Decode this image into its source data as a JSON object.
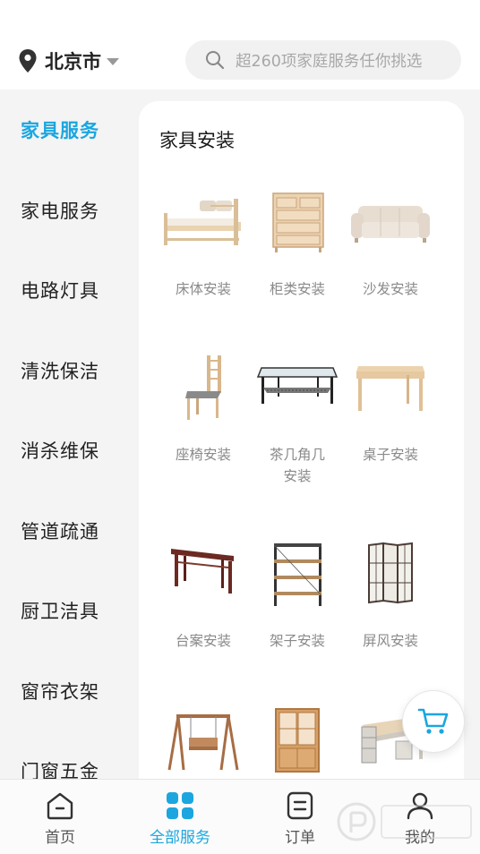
{
  "header": {
    "city": "北京市",
    "search_placeholder": "超260项家庭服务任你挑选"
  },
  "sidebar": {
    "items": [
      {
        "label": "家具服务",
        "active": true
      },
      {
        "label": "家电服务",
        "active": false
      },
      {
        "label": "电路灯具",
        "active": false
      },
      {
        "label": "清洗保洁",
        "active": false
      },
      {
        "label": "消杀维保",
        "active": false
      },
      {
        "label": "管道疏通",
        "active": false
      },
      {
        "label": "厨卫洁具",
        "active": false
      },
      {
        "label": "窗帘衣架",
        "active": false
      },
      {
        "label": "门窗五金",
        "active": false
      }
    ]
  },
  "content": {
    "title": "家具安装",
    "items": [
      {
        "label": "床体安装",
        "icon": "bed-icon"
      },
      {
        "label": "柜类安装",
        "icon": "cabinet-icon"
      },
      {
        "label": "沙发安装",
        "icon": "sofa-icon"
      },
      {
        "label": "座椅安装",
        "icon": "chair-icon"
      },
      {
        "label": "茶几角几安装",
        "icon": "coffee-table-icon"
      },
      {
        "label": "桌子安装",
        "icon": "desk-icon"
      },
      {
        "label": "台案安装",
        "icon": "console-table-icon"
      },
      {
        "label": "架子安装",
        "icon": "shelf-icon"
      },
      {
        "label": "屏风安装",
        "icon": "screen-icon"
      },
      {
        "label": "",
        "icon": "swing-icon"
      },
      {
        "label": "",
        "icon": "display-cabinet-icon"
      },
      {
        "label": "",
        "icon": "office-desk-icon"
      }
    ]
  },
  "tabbar": {
    "tabs": [
      {
        "label": "首页",
        "icon": "home-icon",
        "active": false
      },
      {
        "label": "全部服务",
        "icon": "grid-icon",
        "active": true
      },
      {
        "label": "订单",
        "icon": "order-icon",
        "active": false
      },
      {
        "label": "我的",
        "icon": "profile-icon",
        "active": false
      }
    ]
  },
  "colors": {
    "accent": "#1ba6df",
    "text": "#222222",
    "muted": "#8a8a8a",
    "background": "#f4f4f4"
  }
}
